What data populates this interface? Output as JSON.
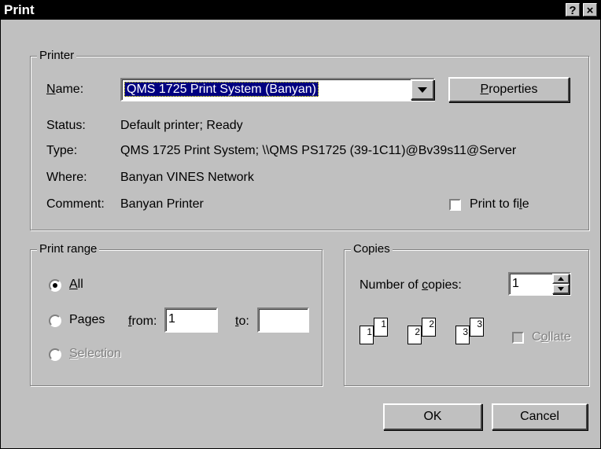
{
  "window": {
    "title": "Print",
    "help_glyph": "?",
    "close_glyph": "×"
  },
  "printer": {
    "legend": "Printer",
    "name_label": "Name:",
    "name_value": "QMS 1725 Print System (Banyan)",
    "properties_button": "Properties",
    "status_label": "Status:",
    "status_value": "Default printer; Ready",
    "type_label": "Type:",
    "type_value": "QMS 1725 Print System; \\\\QMS PS1725 (39-1C11)@Bv39s11@Server",
    "where_label": "Where:",
    "where_value": "Banyan VINES Network",
    "comment_label": "Comment:",
    "comment_value": "Banyan Printer",
    "print_to_file_label": "Print to file",
    "print_to_file_checked": false
  },
  "print_range": {
    "legend": "Print range",
    "all_label": "All",
    "pages_label": "Pages",
    "from_label": "from:",
    "from_value": "1",
    "to_label": "to:",
    "to_value": "",
    "selection_label": "Selection",
    "selected": "all"
  },
  "copies": {
    "legend": "Copies",
    "number_label": "Number of copies:",
    "number_value": "1",
    "collate_label": "Collate",
    "collate_checked": false,
    "page_numbers": [
      "1",
      "1",
      "2",
      "2",
      "3",
      "3"
    ]
  },
  "buttons": {
    "ok": "OK",
    "cancel": "Cancel"
  }
}
